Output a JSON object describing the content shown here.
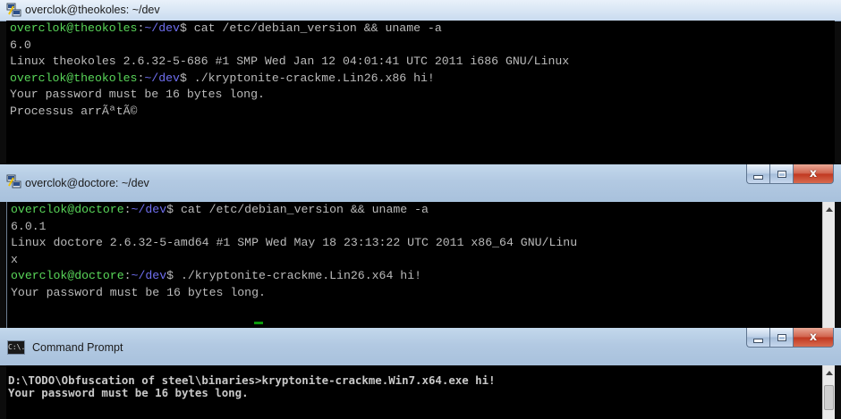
{
  "windows": [
    {
      "title": "overclok@theokoles: ~/dev",
      "lines": [
        {
          "user": "overclok@theokoles",
          "path": "~/dev",
          "command": "cat /etc/debian_version && uname -a"
        },
        {
          "text": "6.0"
        },
        {
          "text": "Linux theokoles 2.6.32-5-686 #1 SMP Wed Jan 12 04:01:41 UTC 2011 i686 GNU/Linux"
        },
        {
          "user": "overclok@theokoles",
          "path": "~/dev",
          "command": "./kryptonite-crackme.Lin26.x86 hi!"
        },
        {
          "text": "Your password must be 16 bytes long."
        },
        {
          "text": "Processus arrÃªtÃ©"
        }
      ]
    },
    {
      "title": "overclok@doctore: ~/dev",
      "lines": [
        {
          "user": "overclok@doctore",
          "path": "~/dev",
          "command": "cat /etc/debian_version && uname -a"
        },
        {
          "text": "6.0.1"
        },
        {
          "text": "Linux doctore 2.6.32-5-amd64 #1 SMP Wed May 18 23:13:22 UTC 2011 x86_64 GNU/Linu"
        },
        {
          "text": "x"
        },
        {
          "user": "overclok@doctore",
          "path": "~/dev",
          "command": "./kryptonite-crackme.Lin26.x64 hi!"
        },
        {
          "text": "Your password must be 16 bytes long."
        }
      ]
    },
    {
      "title": "Command Prompt",
      "icon_label": "C:\\.",
      "lines": [
        {
          "text": "D:\\TODO\\Obfuscation of steel\\binaries>kryptonite-crackme.Win7.x64.exe hi!"
        },
        {
          "text": "Your password must be 16 bytes long."
        }
      ]
    }
  ],
  "caption": {
    "close_glyph": "x"
  },
  "prompt_sep": "$ ",
  "colors": {
    "prompt_user": "#59d659",
    "prompt_path": "#6f6ff0",
    "text": "#bbbbbb",
    "background": "#000000"
  }
}
